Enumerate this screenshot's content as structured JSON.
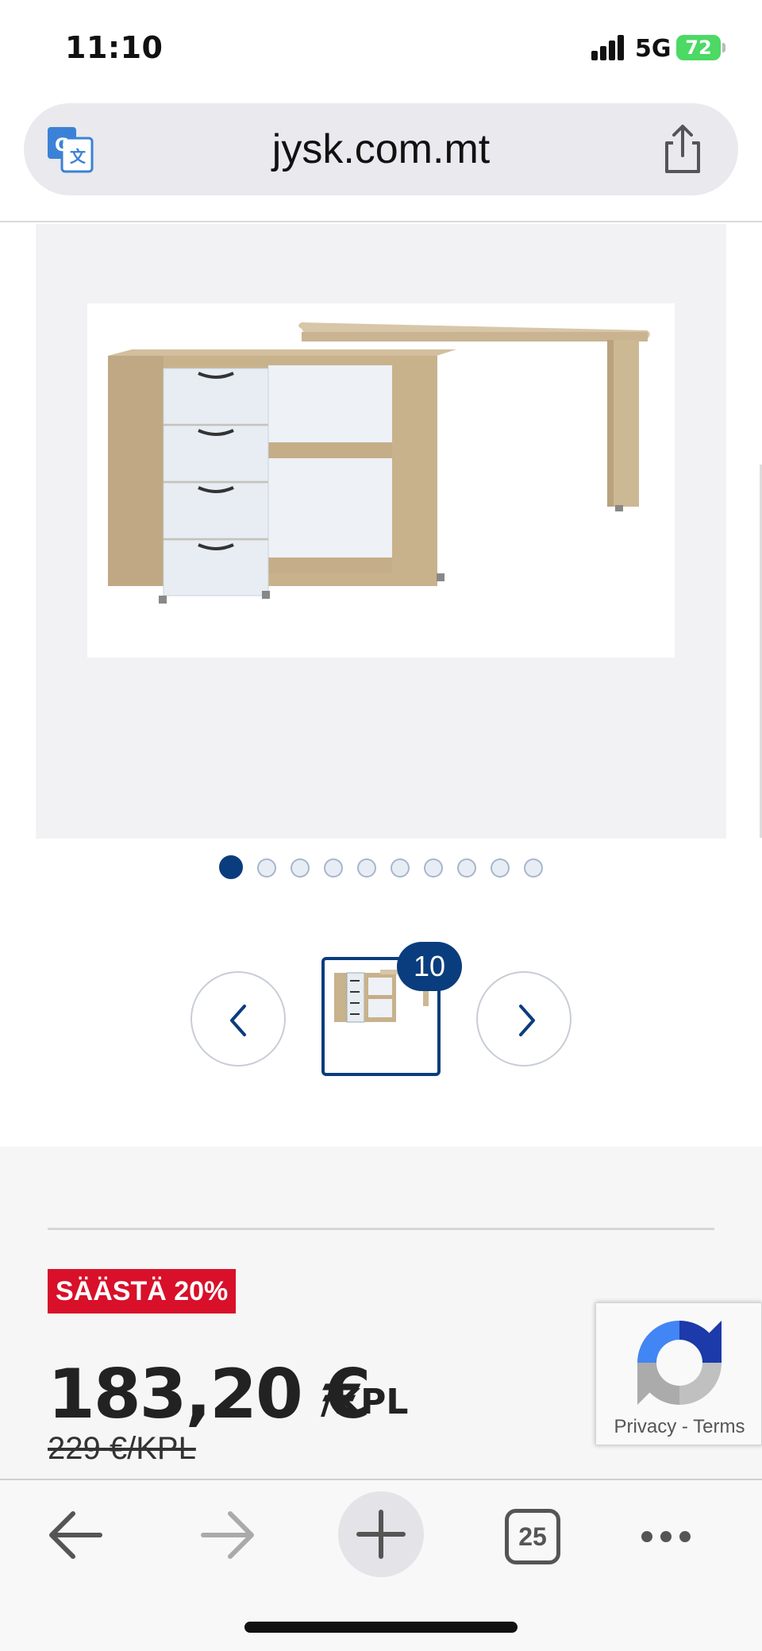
{
  "status_bar": {
    "time": "11:10",
    "network": "5G",
    "battery": "72"
  },
  "browser": {
    "url": "jysk.com.mt",
    "translate_icon": "google-translate-icon",
    "share_icon": "share-icon"
  },
  "gallery": {
    "image_alt": "Corner desk with drawers and shelves",
    "dot_count": 10,
    "active_dot": 1,
    "thumbnail_badge": "10",
    "prev_icon": "chevron-left-icon",
    "next_icon": "chevron-right-icon"
  },
  "pricing": {
    "save_badge": "SÄÄSTÄ 20%",
    "price": "183,20 €",
    "unit": "/KPL",
    "old_price": "229 €/KPL"
  },
  "recaptcha": {
    "privacy": "Privacy",
    "separator": "-",
    "terms": "Terms"
  },
  "toolbar": {
    "tab_count": "25",
    "back_icon": "arrow-left-icon",
    "forward_icon": "arrow-right-icon",
    "new_tab_icon": "plus-icon",
    "tabs_icon": "tabs-icon",
    "more_icon": "more-icon"
  },
  "colors": {
    "brand_blue": "#0a3d7d",
    "sale_red": "#d8102a",
    "battery_green": "#4cd964"
  }
}
